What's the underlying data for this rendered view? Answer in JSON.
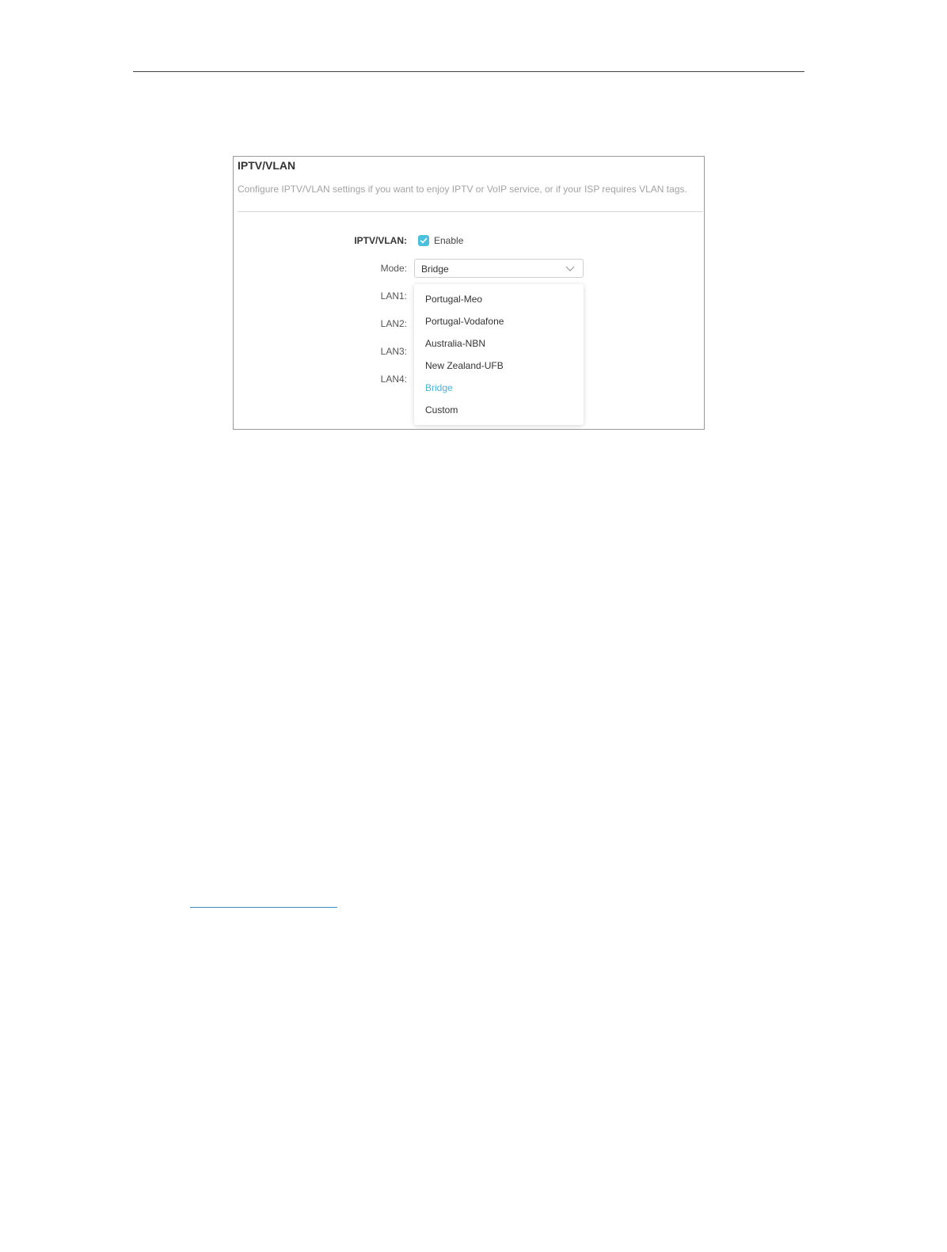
{
  "panel": {
    "title": "IPTV/VLAN",
    "description": "Configure IPTV/VLAN settings if you want to enjoy IPTV or VoIP service, or if your ISP requires VLAN tags."
  },
  "form": {
    "iptv_label": "IPTV/VLAN:",
    "enable_label": "Enable",
    "enable_checked": true,
    "mode_label": "Mode:",
    "mode_value": "Bridge",
    "lan_labels": [
      "LAN1:",
      "LAN2:",
      "LAN3:",
      "LAN4:"
    ]
  },
  "dropdown": {
    "options": [
      "Portugal-Meo",
      "Portugal-Vodafone",
      "Australia-NBN",
      "New Zealand-UFB",
      "Bridge",
      "Custom"
    ],
    "selected": "Bridge"
  },
  "colors": {
    "accent": "#4bc0dd",
    "selected_option": "#4bb3d6",
    "link": "#3f8fc7"
  },
  "icons": {
    "checkbox": "check-icon",
    "select_arrow": "chevron-down-icon"
  }
}
